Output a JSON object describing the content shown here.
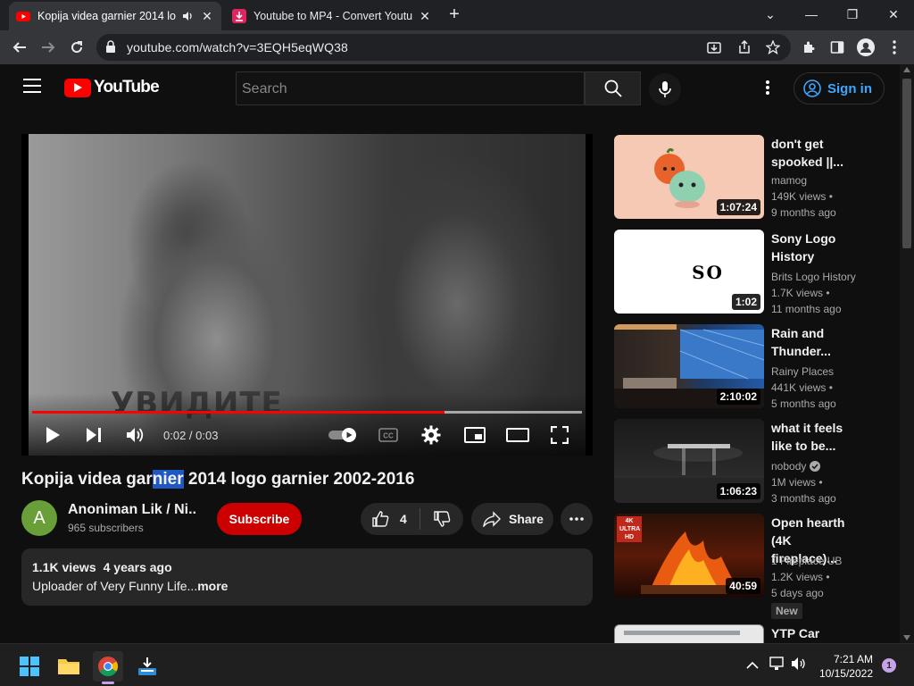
{
  "browser": {
    "tabs": [
      {
        "title": "Kopija videa garnier 2014 lo",
        "active": true
      },
      {
        "title": "Youtube to MP4 - Convert Youtu",
        "active": false
      }
    ],
    "url": "youtube.com/watch?v=3EQH5eqWQ38"
  },
  "header": {
    "logo_text": "YouTube",
    "search_placeholder": "Search",
    "signin_label": "Sign in"
  },
  "player": {
    "overlay_text": "УВИДИТЕ",
    "time": "0:02 / 0:03",
    "played_fraction": 0.75,
    "loaded_fraction": 1.0
  },
  "video": {
    "title_before": "Kopija videa gar",
    "title_highlight": "nier",
    "title_after": " 2014 logo garnier 2002-2016",
    "channel_initial": "A",
    "channel_name": "Anoniman Lik / Ni...",
    "subscribers": "965 subscribers",
    "subscribe_label": "Subscribe",
    "likes": "4",
    "share_label": "Share",
    "views": "1.1K views",
    "age": "4 years ago",
    "description": "Uploader of Very Funny Life...",
    "more_label": "more"
  },
  "recommendations": [
    {
      "title": "don't get spooked ||...",
      "channel": "mamog",
      "views": "149K views •",
      "age": "9 months ago",
      "duration": "1:07:24"
    },
    {
      "title": "Sony Logo History",
      "channel": "Brits Logo History",
      "views": "1.7K views •",
      "age": "11 months ago",
      "duration": "1:02",
      "thumb_text": "SO"
    },
    {
      "title": "Rain and Thunder...",
      "channel": "Rainy Places",
      "views": "441K views •",
      "age": "5 months ago",
      "duration": "2:10:02"
    },
    {
      "title": "what it feels like to be...",
      "channel": "nobody",
      "views": "1M views •",
      "age": "3 months ago",
      "duration": "1:06:23"
    },
    {
      "title": "Open hearth (4K fireplace)...",
      "channel": "1 Fireplace UB",
      "views": "1.2K views •",
      "age": "5 days ago",
      "duration": "40:59",
      "badge": "New",
      "thumb_text": "4K ULTRA HD"
    },
    {
      "title": "YTP Car Logos",
      "channel": "",
      "views": "",
      "age": "",
      "duration": ""
    }
  ],
  "taskbar": {
    "time": "7:21 AM",
    "date": "10/15/2022",
    "notifications": "1"
  },
  "colors": {
    "accent_red": "#ff0000",
    "subscribe": "#cc0000",
    "link_blue": "#3ea6ff",
    "highlight": "#1e58c0"
  }
}
